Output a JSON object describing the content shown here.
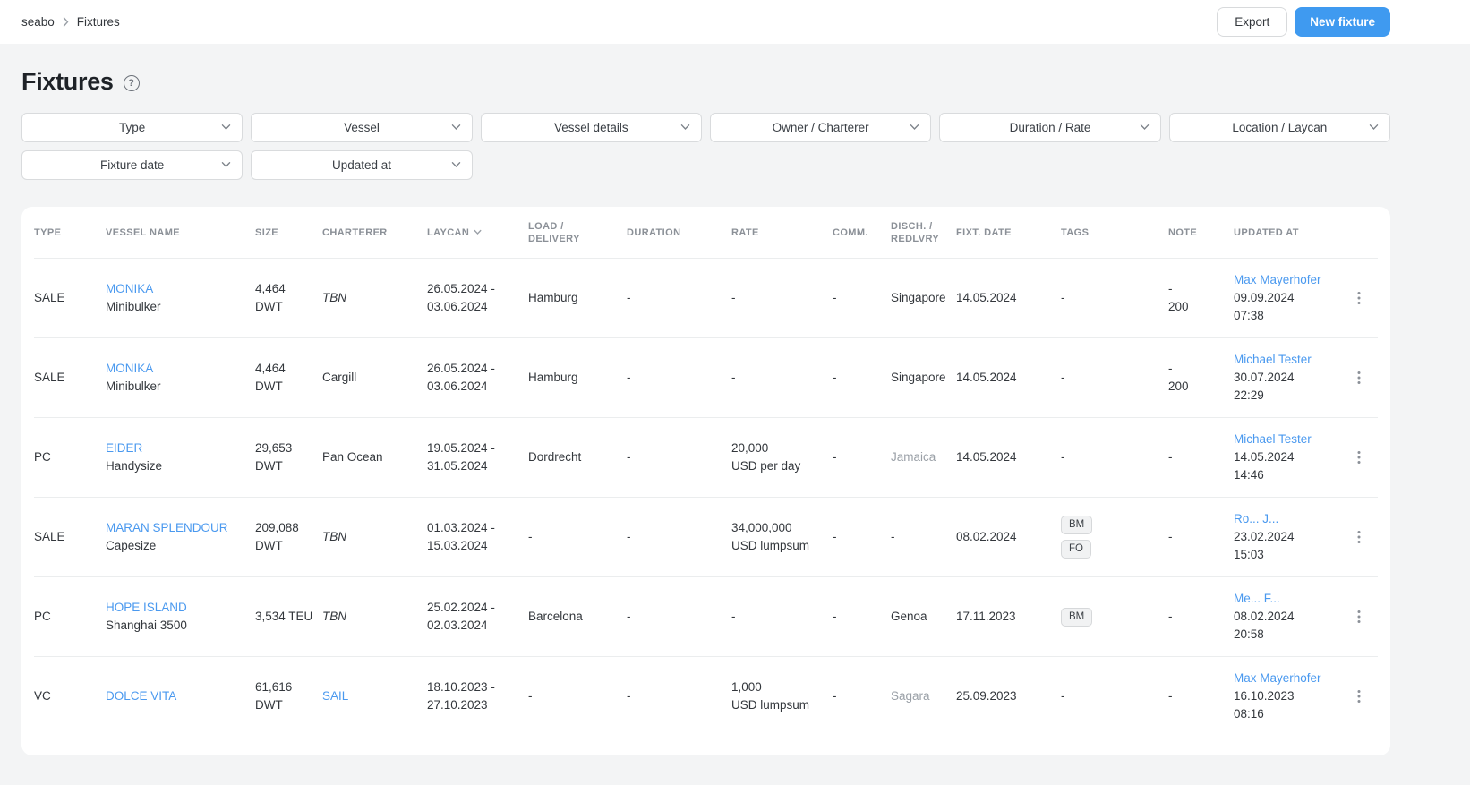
{
  "topbar": {
    "breadcrumb": {
      "root": "seabo",
      "current": "Fixtures"
    },
    "export_label": "Export",
    "new_fixture_label": "New fixture"
  },
  "page": {
    "title": "Fixtures"
  },
  "icons": {
    "help_glyph": "?"
  },
  "filters": {
    "row1": [
      "Type",
      "Vessel",
      "Vessel details",
      "Owner / Charterer",
      "Duration / Rate",
      "Location / Laycan"
    ],
    "row2": [
      "Fixture date",
      "Updated at"
    ]
  },
  "table": {
    "columns": [
      "TYPE",
      "VESSEL NAME",
      "SIZE",
      "CHARTERER",
      "LAYCAN",
      "LOAD / DELIVERY",
      "DURATION",
      "RATE",
      "COMM.",
      "DISCH. / REDLVRY",
      "FIXT. DATE",
      "TAGS",
      "NOTE",
      "UPDATED AT"
    ],
    "rows": [
      {
        "type": "SALE",
        "vessel": {
          "name": "MONIKA",
          "subtitle": "Minibulker"
        },
        "size_lines": [
          "4,464 DWT"
        ],
        "charterer": {
          "text": "TBN",
          "style": "tbn"
        },
        "laycan_lines": [
          "26.05.2024 -",
          "03.06.2024"
        ],
        "load": "Hamburg",
        "duration": "-",
        "rate_lines": [
          "-"
        ],
        "comm": "-",
        "disch": {
          "text": "Singapore",
          "muted": false
        },
        "fixture_date": "14.05.2024",
        "tags": [],
        "note_lines": [
          "-",
          "200"
        ],
        "updated": {
          "user": "Max Mayerhofer",
          "date": "09.09.2024",
          "time": "07:38"
        }
      },
      {
        "type": "SALE",
        "vessel": {
          "name": "MONIKA",
          "subtitle": "Minibulker"
        },
        "size_lines": [
          "4,464 DWT"
        ],
        "charterer": {
          "text": "Cargill",
          "style": "normal"
        },
        "laycan_lines": [
          "26.05.2024 -",
          "03.06.2024"
        ],
        "load": "Hamburg",
        "duration": "-",
        "rate_lines": [
          "-"
        ],
        "comm": "-",
        "disch": {
          "text": "Singapore",
          "muted": false
        },
        "fixture_date": "14.05.2024",
        "tags": [],
        "note_lines": [
          "-",
          "200"
        ],
        "updated": {
          "user": "Michael Tester",
          "date": "30.07.2024",
          "time": "22:29"
        }
      },
      {
        "type": "PC",
        "vessel": {
          "name": "EIDER",
          "subtitle": "Handysize"
        },
        "size_lines": [
          "29,653",
          "DWT"
        ],
        "charterer": {
          "text": "Pan Ocean",
          "style": "normal"
        },
        "laycan_lines": [
          "19.05.2024 -",
          "31.05.2024"
        ],
        "load": "Dordrecht",
        "duration": "-",
        "rate_lines": [
          "20,000",
          "USD per day"
        ],
        "comm": "-",
        "disch": {
          "text": "Jamaica",
          "muted": true
        },
        "fixture_date": "14.05.2024",
        "tags": [],
        "note_lines": [
          "-"
        ],
        "updated": {
          "user": "Michael Tester",
          "date": "14.05.2024",
          "time": "14:46"
        }
      },
      {
        "type": "SALE",
        "vessel": {
          "name": "MARAN SPLENDOUR",
          "subtitle": "Capesize"
        },
        "size_lines": [
          "209,088",
          "DWT"
        ],
        "charterer": {
          "text": "TBN",
          "style": "tbn"
        },
        "laycan_lines": [
          "01.03.2024 -",
          "15.03.2024"
        ],
        "load": "-",
        "duration": "-",
        "rate_lines": [
          "34,000,000",
          "USD lumpsum"
        ],
        "comm": "-",
        "disch": {
          "text": "-",
          "muted": false
        },
        "fixture_date": "08.02.2024",
        "tags": [
          "BM",
          "FO"
        ],
        "note_lines": [
          "-"
        ],
        "updated": {
          "user": "Ro... J...",
          "date": "23.02.2024",
          "time": "15:03"
        }
      },
      {
        "type": "PC",
        "vessel": {
          "name": "HOPE ISLAND",
          "subtitle": "Shanghai 3500"
        },
        "size_lines": [
          "3,534 TEU"
        ],
        "charterer": {
          "text": "TBN",
          "style": "tbn"
        },
        "laycan_lines": [
          "25.02.2024 -",
          "02.03.2024"
        ],
        "load": "Barcelona",
        "duration": "-",
        "rate_lines": [
          "-"
        ],
        "comm": "-",
        "disch": {
          "text": "Genoa",
          "muted": false
        },
        "fixture_date": "17.11.2023",
        "tags": [
          "BM"
        ],
        "note_lines": [
          "-"
        ],
        "updated": {
          "user": "Me... F...",
          "date": "08.02.2024",
          "time": "20:58"
        }
      },
      {
        "type": "VC",
        "vessel": {
          "name": "DOLCE VITA",
          "subtitle": ""
        },
        "size_lines": [
          "61,616",
          "DWT"
        ],
        "charterer": {
          "text": "SAIL",
          "style": "link"
        },
        "laycan_lines": [
          "18.10.2023 -",
          "27.10.2023"
        ],
        "load": "-",
        "duration": "-",
        "rate_lines": [
          "1,000",
          "USD lumpsum"
        ],
        "comm": "-",
        "disch": {
          "text": "Sagara",
          "muted": true
        },
        "fixture_date": "25.09.2023",
        "tags": [],
        "note_lines": [
          "-"
        ],
        "updated": {
          "user": "Max Mayerhofer",
          "date": "16.10.2023",
          "time": "08:16"
        }
      }
    ]
  },
  "colors": {
    "accent": "#3f9af0",
    "link": "#4a99ef",
    "muted_text": "#9aa0a7",
    "page_bg": "#f3f4f5"
  }
}
